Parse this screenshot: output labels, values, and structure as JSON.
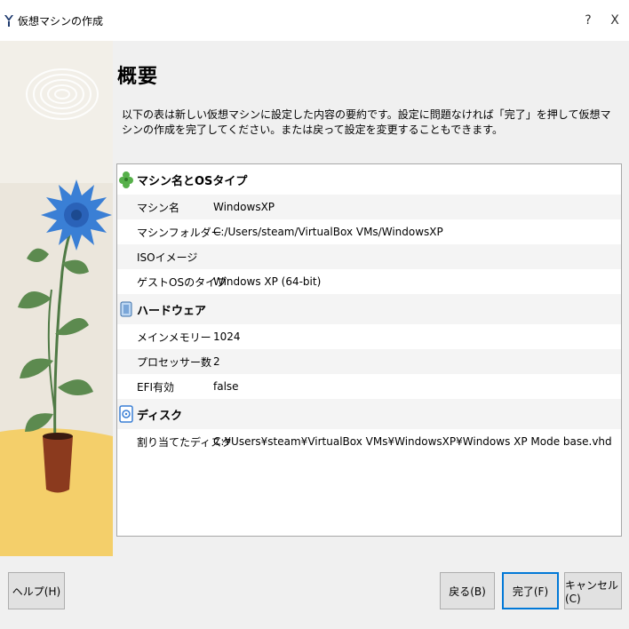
{
  "window": {
    "title": "仮想マシンの作成",
    "help_glyph": "?",
    "close_glyph": "X"
  },
  "page": {
    "title": "概要",
    "description": "以下の表は新しい仮想マシンに設定した内容の要約です。設定に問題なければ「完了」を押して仮想マシンの作成を完了してください。または戻って設定を変更することもできます。"
  },
  "sections": [
    {
      "title": "マシン名とOSタイプ",
      "icon": "gear-puzzle-icon",
      "rows": [
        {
          "label": "マシン名",
          "value": "WindowsXP"
        },
        {
          "label": "マシンフォルダー",
          "value": "C:/Users/steam/VirtualBox VMs/WindowsXP"
        },
        {
          "label": "ISOイメージ",
          "value": ""
        },
        {
          "label": "ゲストOSのタイプ",
          "value": "Windows XP (64-bit)"
        }
      ]
    },
    {
      "title": "ハードウェア",
      "icon": "chip-icon",
      "rows": [
        {
          "label": "メインメモリー",
          "value": "1024"
        },
        {
          "label": "プロセッサー数",
          "value": "2"
        },
        {
          "label": "EFI有効",
          "value": "false"
        }
      ]
    },
    {
      "title": "ディスク",
      "icon": "disk-icon",
      "rows": [
        {
          "label": "割り当てたディスク",
          "value": "C:¥Users¥steam¥VirtualBox VMs¥WindowsXP¥Windows XP Mode base.vhd"
        }
      ]
    }
  ],
  "buttons": {
    "help": "ヘルプ(H)",
    "back": "戻る(B)",
    "finish": "完了(F)",
    "cancel": "キャンセル(C)"
  },
  "colors": {
    "accent": "#0078d7",
    "flower_blue": "#3a7fd5",
    "pot": "#8b3a1e",
    "ground": "#f4cf6a"
  }
}
